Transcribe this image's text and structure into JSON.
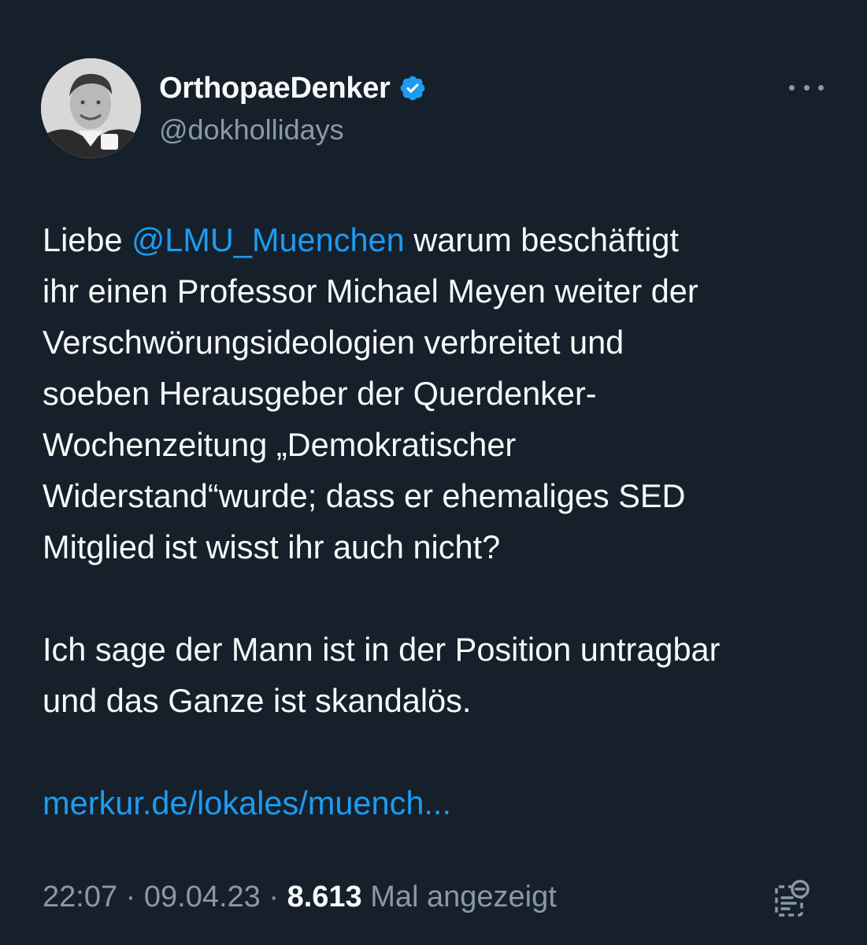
{
  "author": {
    "display_name": "OrthopaeDenker",
    "handle": "@dokhollidays",
    "verified": true
  },
  "tweet": {
    "line1_pre": "Liebe ",
    "mention": "@LMU_Muenchen",
    "line1_post": " warum beschäftigt",
    "line2": "ihr einen Professor Michael Meyen weiter der",
    "line3": "Verschwörungsideologien verbreitet und",
    "line4": "soeben Herausgeber der Querdenker-",
    "line5": "Wochenzeitung „Demokratischer",
    "line6": "Widerstand“wurde; dass er ehemaliges SED",
    "line7": "Mitglied ist wisst ihr auch nicht?",
    "para2_line1": "Ich sage der Mann ist in der Position untragbar",
    "para2_line2": "und das Ganze ist skandalös.",
    "link_text": "merkur.de/lokales/muench..."
  },
  "meta": {
    "time": "22:07",
    "separator": " · ",
    "date": "09.04.23",
    "views_count": "8.613",
    "views_label": " Mal angezeigt"
  },
  "colors": {
    "background": "#15202b",
    "text": "#f7f9f9",
    "secondary": "#8b98a5",
    "accent": "#1d9bf0"
  },
  "icons": {
    "back": "chevron-down-icon",
    "verified": "verified-badge-icon",
    "more": "more-options-icon",
    "analytics": "analytics-icon"
  }
}
